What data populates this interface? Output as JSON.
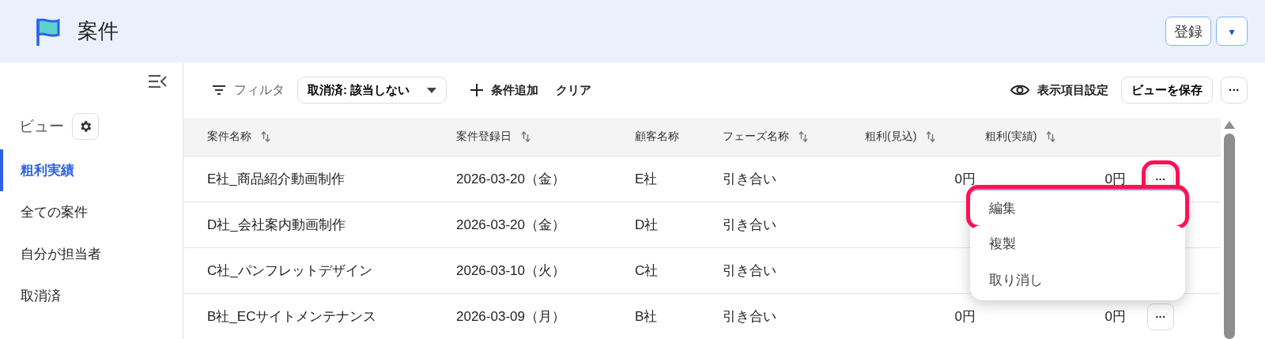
{
  "header": {
    "title": "案件",
    "register_button": "登録",
    "dropdown_button": "▾"
  },
  "sidebar": {
    "view_label": "ビュー",
    "items": [
      {
        "label": "粗利実績",
        "selected": true
      },
      {
        "label": "全ての案件",
        "selected": false
      },
      {
        "label": "自分が担当者",
        "selected": false
      },
      {
        "label": "取消済",
        "selected": false
      }
    ]
  },
  "toolbar": {
    "filter_label": "フィルタ",
    "filter_chip": "取消済: 該当しない",
    "add_condition": "条件追加",
    "clear": "クリア",
    "display_settings": "表示項目設定",
    "save_view": "ビューを保存",
    "more": "···"
  },
  "table": {
    "columns": [
      {
        "label": "案件名称",
        "sortable": true
      },
      {
        "label": "案件登録日",
        "sortable": true
      },
      {
        "label": "顧客名称",
        "sortable": false
      },
      {
        "label": "フェーズ名称",
        "sortable": true
      },
      {
        "label": "粗利(見込)",
        "sortable": true
      },
      {
        "label": "粗利(実績)",
        "sortable": true
      }
    ],
    "rows": [
      {
        "cells": [
          "E社_商品紹介動画制作",
          "2026-03-20（金）",
          "E社",
          "引き合い",
          "0円",
          "0円"
        ],
        "menu_button": "···",
        "highlighted": true
      },
      {
        "cells": [
          "D社_会社案内動画制作",
          "2026-03-20（金）",
          "D社",
          "引き合い"
        ]
      },
      {
        "cells": [
          "C社_パンフレットデザイン",
          "2026-03-10（火）",
          "C社",
          "引き合い"
        ]
      },
      {
        "cells": [
          "B社_ECサイトメンテナンス",
          "2026-03-09（月）",
          "B社",
          "引き合い",
          "0円",
          "0円"
        ],
        "menu_button": "···",
        "highlighted": false
      }
    ]
  },
  "row_menu": {
    "items": [
      {
        "label": "編集",
        "highlighted": true
      },
      {
        "label": "複製",
        "highlighted": false
      },
      {
        "label": "取り消し",
        "highlighted": false
      }
    ]
  }
}
